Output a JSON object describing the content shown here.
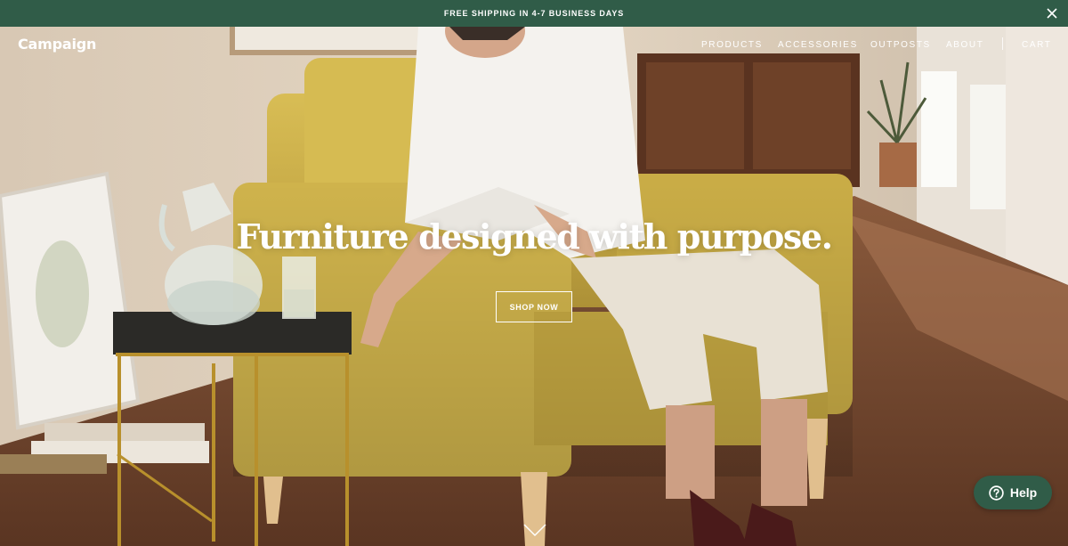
{
  "promo": {
    "message": "FREE SHIPPING IN 4-7 BUSINESS DAYS",
    "close_icon": "close-icon"
  },
  "header": {
    "logo": "Campaign",
    "nav": {
      "products": "PRODUCTS",
      "accessories": "ACCESSORIES",
      "outposts": "OUTPOSTS",
      "about": "ABOUT",
      "cart": "CART"
    }
  },
  "hero": {
    "headline": "Furniture designed with purpose.",
    "cta_label": "SHOP NOW",
    "scroll_icon": "chevron-down-icon"
  },
  "help": {
    "label": "Help",
    "icon": "question-circle-icon"
  },
  "colors": {
    "brand_green": "#305c48",
    "text_on_dark": "#ffffff"
  }
}
